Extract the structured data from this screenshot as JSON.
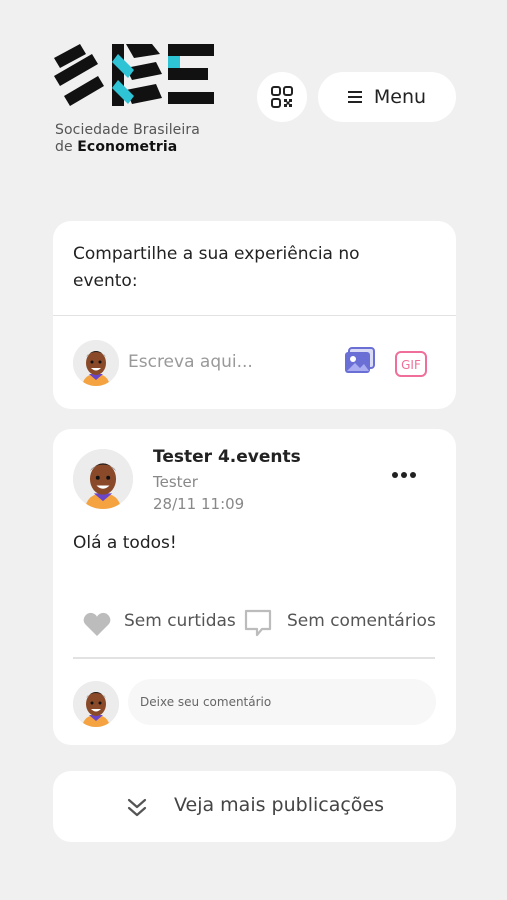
{
  "header": {
    "logo_text": "SBE",
    "org_line1": "Sociedade Brasileira",
    "org_line2_prefix": "de ",
    "org_line2_bold": "Econometria",
    "menu_label": "Menu"
  },
  "share": {
    "title": "Compartilhe a sua experiência no evento:",
    "placeholder": "Escreva aqui...",
    "gif_label": "GIF"
  },
  "post": {
    "author": "Tester 4.events",
    "role": "Tester",
    "timestamp": "28/11 11:09",
    "text": "Olá a todos!",
    "likes_label": "Sem curtidas",
    "comments_label": "Sem comentários",
    "comment_placeholder": "Deixe seu comentário"
  },
  "feed": {
    "more_label": "Veja mais publicações"
  },
  "colors": {
    "accent_teal": "#2ec4d6",
    "icon_purple": "#6a6fd6",
    "gif_pink": "#ef6f9a"
  }
}
